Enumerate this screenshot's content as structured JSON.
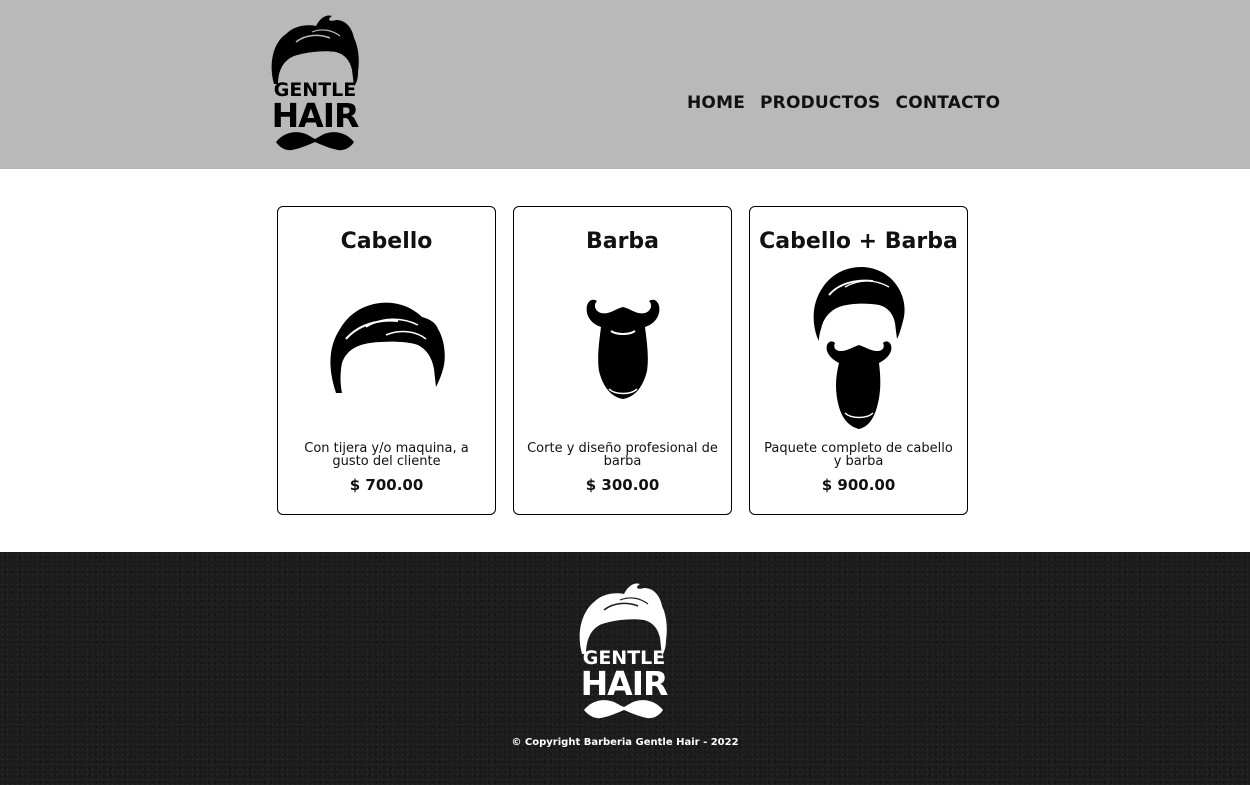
{
  "brand": {
    "line1": "GENTLE",
    "line2": "HAIR"
  },
  "nav": [
    {
      "label": "HOME"
    },
    {
      "label": "PRODUCTOS"
    },
    {
      "label": "CONTACTO"
    }
  ],
  "products": [
    {
      "title": "Cabello",
      "description": "Con tijera y/o maquina, a gusto del cliente",
      "price": "$ 700.00",
      "icon": "hair-icon"
    },
    {
      "title": "Barba",
      "description": "Corte y diseño profesional de barba",
      "price": "$ 300.00",
      "icon": "beard-icon"
    },
    {
      "title": "Cabello + Barba",
      "description": "Paquete completo de cabello y barba",
      "price": "$ 900.00",
      "icon": "hair-and-beard-icon"
    }
  ],
  "footer": {
    "copyright": "© Copyright Barberia Gentle Hair - 2022"
  },
  "colors": {
    "header_bg": "#b9b9b9",
    "footer_bg": "#1c1c1c",
    "text": "#111111"
  }
}
